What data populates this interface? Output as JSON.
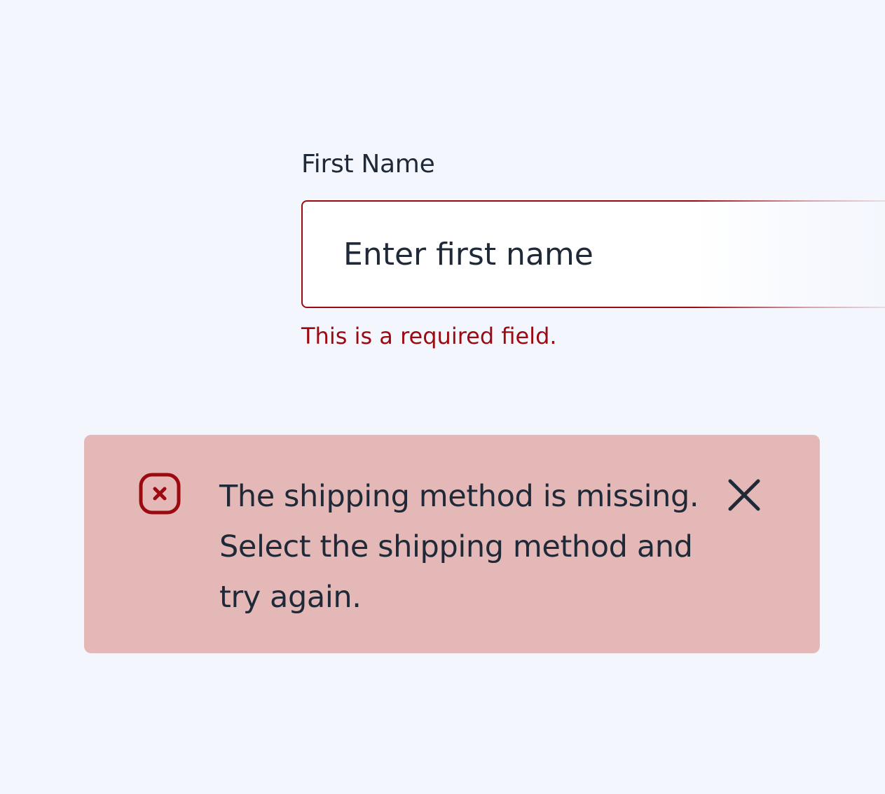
{
  "form": {
    "first_name": {
      "label": "First Name",
      "placeholder": "Enter first name",
      "value": "",
      "error": "This is a required field."
    }
  },
  "alert": {
    "type": "error",
    "icon": "error-x-icon",
    "message": "The shipping method is missing. Select the shipping method and try again.",
    "close_icon": "close-icon"
  },
  "colors": {
    "background": "#f3f6fd",
    "error": "#9b0a10",
    "alert_background": "#e5b8b8",
    "text": "#1f2937"
  }
}
